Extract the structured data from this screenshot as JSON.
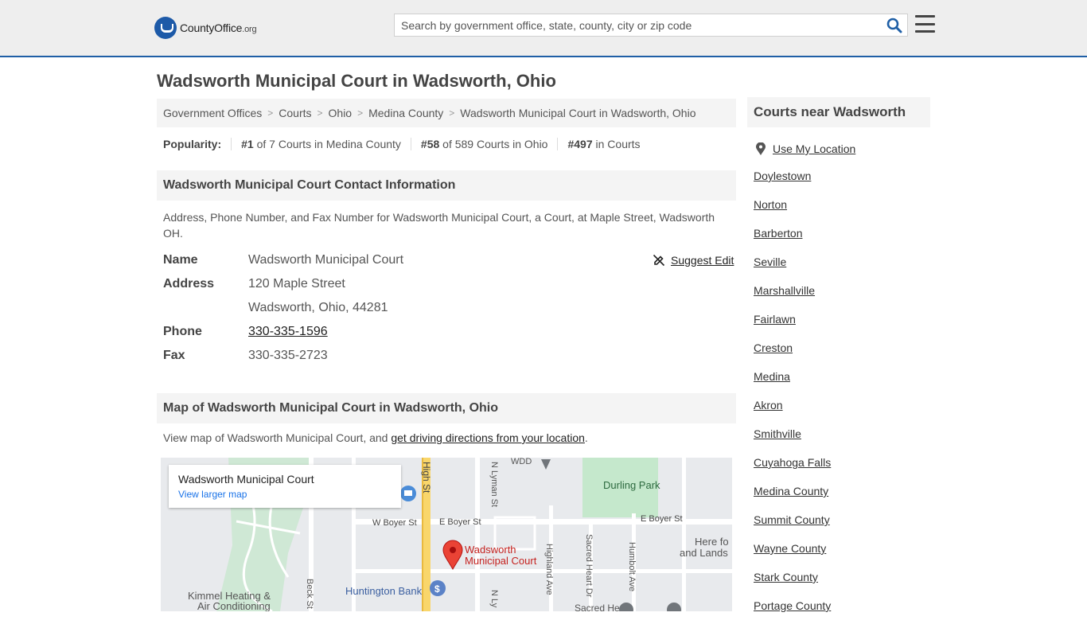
{
  "header": {
    "logo_text": "CountyOffice",
    "logo_suffix": ".org",
    "search_placeholder": "Search by government office, state, county, city or zip code"
  },
  "page": {
    "title": "Wadsworth Municipal Court in Wadsworth, Ohio"
  },
  "breadcrumb": [
    "Government Offices",
    "Courts",
    "Ohio",
    "Medina County",
    "Wadsworth Municipal Court in Wadsworth, Ohio"
  ],
  "popularity": {
    "label": "Popularity:",
    "county_rank": "#1",
    "county_text": "of 7 Courts in Medina County",
    "state_rank": "#58",
    "state_text": "of 589 Courts in Ohio",
    "national_rank": "#497",
    "national_text": "in Courts"
  },
  "contact": {
    "heading": "Wadsworth Municipal Court Contact Information",
    "description": "Address, Phone Number, and Fax Number for Wadsworth Municipal Court, a Court, at Maple Street, Wadsworth OH.",
    "suggest_edit": "Suggest Edit",
    "name_label": "Name",
    "name_value": "Wadsworth Municipal Court",
    "address_label": "Address",
    "address_line1": "120 Maple Street",
    "address_line2": "Wadsworth, Ohio, 44281",
    "phone_label": "Phone",
    "phone_value": "330-335-1596",
    "fax_label": "Fax",
    "fax_value": "330-335-2723"
  },
  "map_section": {
    "heading": "Map of Wadsworth Municipal Court in Wadsworth, Ohio",
    "desc_prefix": "View map of Wadsworth Municipal Court, and ",
    "desc_link": "get driving directions from your location",
    "desc_suffix": ".",
    "card_title": "Wadsworth Municipal Court",
    "card_link": "View larger map",
    "labels": {
      "high_st": "High St",
      "n_lyman_st": "N Lyman St",
      "w_boyer_st": "W Boyer St",
      "e_boyer_st": "E Boyer St",
      "e_boyer_st_2": "E Boyer St",
      "durling_park": "Durling Park",
      "wdd": "WDD",
      "highland_ave": "Highland Ave",
      "sacred_heart_dr": "Sacred Heart Dr",
      "humbolt_ave": "Humbolt Ave",
      "pin_label_1": "Wadsworth",
      "pin_label_2": "Municipal Court",
      "huntington_bank": "Huntington Bank",
      "kimmel_1": "Kimmel Heating &",
      "kimmel_2": "Air Conditioning",
      "beck_st": "Beck St",
      "here_for_1": "Here fo",
      "here_for_2": "and Lands",
      "sacred_heart": "Sacred Heart",
      "n_ly": "N Ly"
    }
  },
  "sidebar": {
    "heading": "Courts near Wadsworth",
    "use_location": "Use My Location",
    "items": [
      "Doylestown",
      "Norton",
      "Barberton",
      "Seville",
      "Marshallville",
      "Fairlawn",
      "Creston",
      "Medina",
      "Akron",
      "Smithville",
      "Cuyahoga Falls",
      "Medina County",
      "Summit County",
      "Wayne County",
      "Stark County",
      "Portage County"
    ]
  }
}
